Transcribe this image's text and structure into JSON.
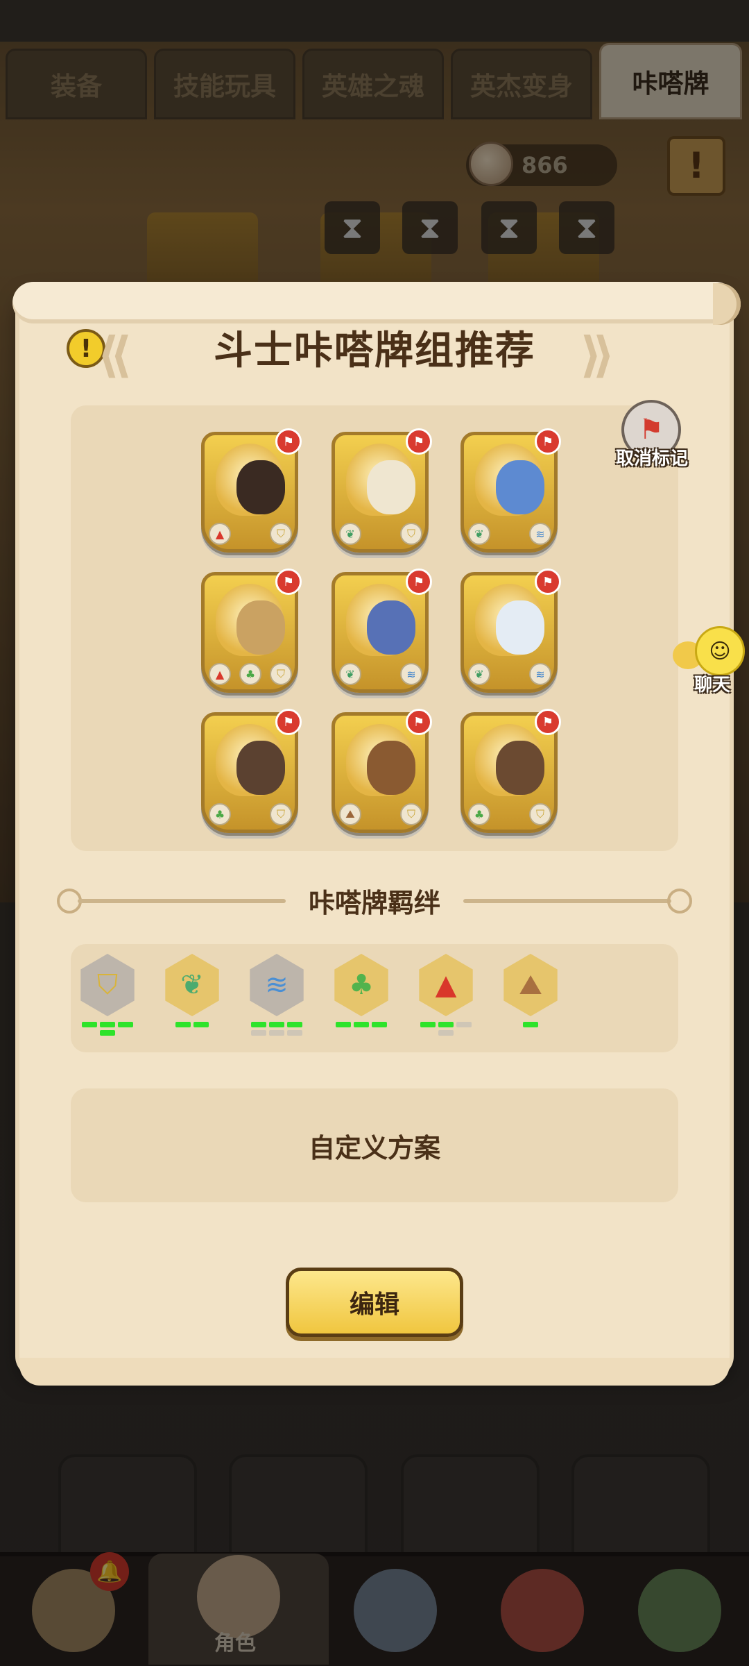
{
  "top_tabs": [
    "装备",
    "技能玩具",
    "英雄之魂",
    "英杰变身",
    "咔嗒牌"
  ],
  "active_tab": "咔嗒牌",
  "currency": {
    "amount": "866",
    "icon": "shell-coin-icon"
  },
  "panel": {
    "title": "斗士咔嗒牌组推荐",
    "cancel_mark_label": "取消标记",
    "chat_label": "聊天",
    "bond_title": "咔嗒牌羁绊",
    "custom_plan_label": "自定义方案",
    "edit_button_label": "编辑"
  },
  "cards": [
    {
      "creature": "lava-golem",
      "color": "#3a2a22",
      "elements": [
        "volcano",
        "shield"
      ]
    },
    {
      "creature": "horned-ram",
      "color": "#efe6d0",
      "elements": [
        "leaf",
        "shield"
      ]
    },
    {
      "creature": "blue-dragon",
      "color": "#5d8ad1",
      "elements": [
        "leaf",
        "wind"
      ]
    },
    {
      "creature": "stone-golem",
      "color": "#caa262",
      "elements": [
        "volcano",
        "cactus",
        "shield"
      ]
    },
    {
      "creature": "blue-wolf",
      "color": "#5771b6",
      "elements": [
        "leaf",
        "wind"
      ]
    },
    {
      "creature": "white-dragon",
      "color": "#e4ecf4",
      "elements": [
        "leaf",
        "wind"
      ]
    },
    {
      "creature": "sand-serpent",
      "color": "#5b4130",
      "elements": [
        "cactus",
        "shield"
      ]
    },
    {
      "creature": "rock-crab",
      "color": "#8a5a31",
      "elements": [
        "mountain",
        "shield"
      ]
    },
    {
      "creature": "earth-bird",
      "color": "#6b4a31",
      "elements": [
        "cactus",
        "shield"
      ]
    }
  ],
  "bonds": [
    {
      "icon": "shield-icon",
      "active": 4,
      "total": 4,
      "color": "#d9b43a"
    },
    {
      "icon": "leaf-icon",
      "active": 2,
      "total": 2,
      "color": "#4cab6f"
    },
    {
      "icon": "wind-icon",
      "active": 3,
      "total": 6,
      "color": "#4a8fd4"
    },
    {
      "icon": "cactus-icon",
      "active": 3,
      "total": 3,
      "color": "#52b34d"
    },
    {
      "icon": "volcano-icon",
      "active": 2,
      "total": 4,
      "color": "#d9372b"
    },
    {
      "icon": "mountain-icon",
      "active": 1,
      "total": 1,
      "color": "#a87040"
    }
  ],
  "bottom_nav": [
    {
      "name": "yeti-hero-icon",
      "label": ""
    },
    {
      "name": "role-character-icon",
      "label": "角色"
    },
    {
      "name": "weapon-icon",
      "label": ""
    },
    {
      "name": "red-creature-icon",
      "label": ""
    },
    {
      "name": "totem-icon",
      "label": ""
    }
  ]
}
